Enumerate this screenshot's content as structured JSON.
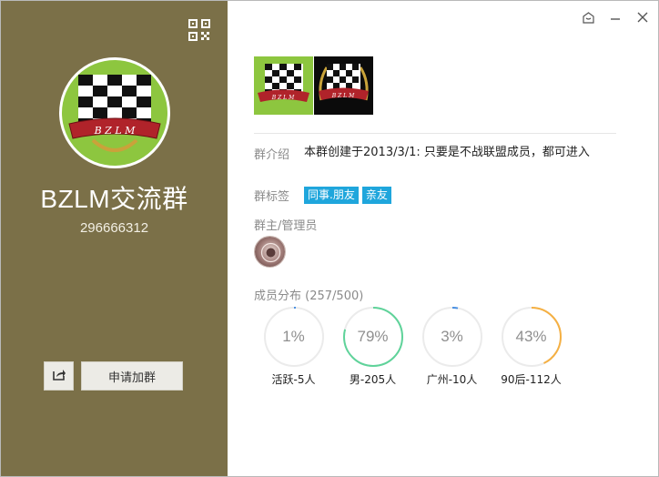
{
  "group": {
    "name": "BZLM交流群",
    "id": "296666312",
    "join_label": "申请加群",
    "intro_label": "群介绍",
    "intro_text": "本群创建于2013/3/1: 只要是不战联盟成员，都可进入",
    "tags_label": "群标签",
    "tags": [
      "同事.朋友",
      "亲友"
    ],
    "admins_label": "群主/管理员",
    "members_label": "成员分布",
    "members_count": "(257/500)"
  },
  "stats": [
    {
      "pct": "1%",
      "value": 0.01,
      "label": "活跃-5人",
      "color": "#4a90e2"
    },
    {
      "pct": "79%",
      "value": 0.79,
      "label": "男-205人",
      "color": "#5fd39a"
    },
    {
      "pct": "3%",
      "value": 0.03,
      "label": "广州-10人",
      "color": "#4a90e2"
    },
    {
      "pct": "43%",
      "value": 0.43,
      "label": "90后-112人",
      "color": "#f5b043"
    }
  ],
  "icons": {
    "qr": "qr-code-icon",
    "share": "share-icon",
    "skin": "skin-icon",
    "minimize": "minimize-icon",
    "close": "close-icon"
  },
  "colors": {
    "left_panel": "#7b7048",
    "tag": "#1fa6dc"
  }
}
